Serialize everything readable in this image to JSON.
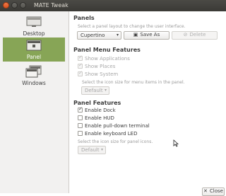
{
  "window": {
    "title": "MATE Tweak"
  },
  "sidebar": {
    "items": [
      {
        "label": "Desktop",
        "icon": "desktop-icon",
        "active": false
      },
      {
        "label": "Panel",
        "icon": "panel-icon",
        "active": true
      },
      {
        "label": "Windows",
        "icon": "windows-icon",
        "active": false
      }
    ]
  },
  "panels": {
    "title": "Panels",
    "hint": "Select a panel layout to change the user interface.",
    "layout_value": "Cupertino",
    "save_as_label": "Save As",
    "delete_label": "Delete"
  },
  "menu_features": {
    "title": "Panel Menu Features",
    "options": [
      {
        "label": "Show Applications",
        "checked": true,
        "enabled": false
      },
      {
        "label": "Show Places",
        "checked": true,
        "enabled": false
      },
      {
        "label": "Show System",
        "checked": true,
        "enabled": false
      }
    ],
    "icon_size_hint": "Select the icon size for menu items in the panel.",
    "icon_size_value": "Default"
  },
  "panel_features": {
    "title": "Panel Features",
    "options": [
      {
        "label": "Enable Dock",
        "checked": true,
        "enabled": true
      },
      {
        "label": "Enable HUD",
        "checked": false,
        "enabled": true
      },
      {
        "label": "Enable pull-down terminal",
        "checked": false,
        "enabled": true
      },
      {
        "label": "Enable keyboard LED",
        "checked": false,
        "enabled": true
      }
    ],
    "icon_size_hint": "Select the icon size for panel icons.",
    "icon_size_value": "Default"
  },
  "footer": {
    "close_label": "Close"
  },
  "colors": {
    "accent": "#87a556",
    "titlebar": "#3f3e3a",
    "close_button": "#e8622f"
  }
}
